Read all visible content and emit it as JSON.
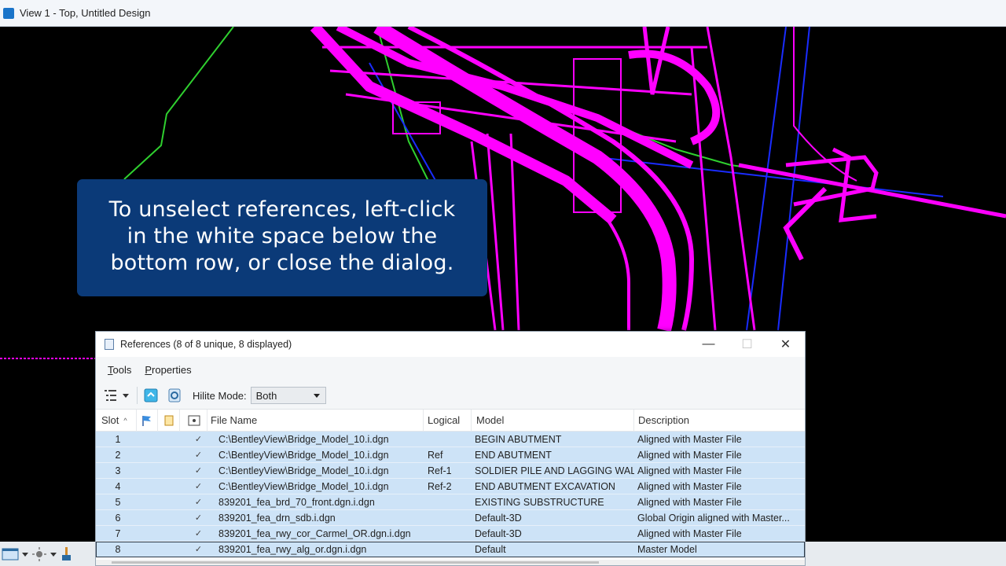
{
  "window": {
    "title": "View 1 - Top, Untitled Design"
  },
  "callout": {
    "lines": [
      "To unselect references, left-click",
      "in the white space below the",
      "bottom row, or close the dialog."
    ]
  },
  "dialog": {
    "title": "References (8 of 8 unique, 8 displayed)",
    "menu": {
      "tools": "Tools",
      "properties": "Properties"
    },
    "toolbar": {
      "hilite_label": "Hilite Mode:",
      "hilite_value": "Both"
    },
    "columns": {
      "slot": "Slot",
      "file": "File Name",
      "logical": "Logical",
      "model": "Model",
      "description": "Description"
    },
    "rows": [
      {
        "slot": "1",
        "check": "✓",
        "file": "C:\\BentleyView\\Bridge_Model_10.i.dgn",
        "logical": "",
        "model": "BEGIN ABUTMENT",
        "description": "Aligned with Master File"
      },
      {
        "slot": "2",
        "check": "✓",
        "file": "C:\\BentleyView\\Bridge_Model_10.i.dgn",
        "logical": "Ref",
        "model": "END ABUTMENT",
        "description": "Aligned with Master File"
      },
      {
        "slot": "3",
        "check": "✓",
        "file": "C:\\BentleyView\\Bridge_Model_10.i.dgn",
        "logical": "Ref-1",
        "model": "SOLDIER PILE AND LAGGING WALL",
        "description": "Aligned with Master File"
      },
      {
        "slot": "4",
        "check": "✓",
        "file": "C:\\BentleyView\\Bridge_Model_10.i.dgn",
        "logical": "Ref-2",
        "model": "END ABUTMENT EXCAVATION",
        "description": "Aligned with Master File"
      },
      {
        "slot": "5",
        "check": "✓",
        "file": "839201_fea_brd_70_front.dgn.i.dgn",
        "logical": "",
        "model": "EXISTING SUBSTRUCTURE",
        "description": "Aligned with Master File"
      },
      {
        "slot": "6",
        "check": "✓",
        "file": "839201_fea_drn_sdb.i.dgn",
        "logical": "",
        "model": "Default-3D",
        "description": "Global Origin aligned with Master..."
      },
      {
        "slot": "7",
        "check": "✓",
        "file": "839201_fea_rwy_cor_Carmel_OR.dgn.i.dgn",
        "logical": "",
        "model": "Default-3D",
        "description": "Aligned with Master File"
      },
      {
        "slot": "8",
        "check": "✓",
        "file": "839201_fea_rwy_alg_or.dgn.i.dgn",
        "logical": "",
        "model": "Default",
        "description": "Master Model"
      }
    ]
  },
  "colors": {
    "cad_magenta": "#ff00ff",
    "cad_green": "#2fd02f",
    "cad_blue": "#1a2cff",
    "callout_bg": "#0b3a78",
    "row_selected": "#cde3f7"
  }
}
